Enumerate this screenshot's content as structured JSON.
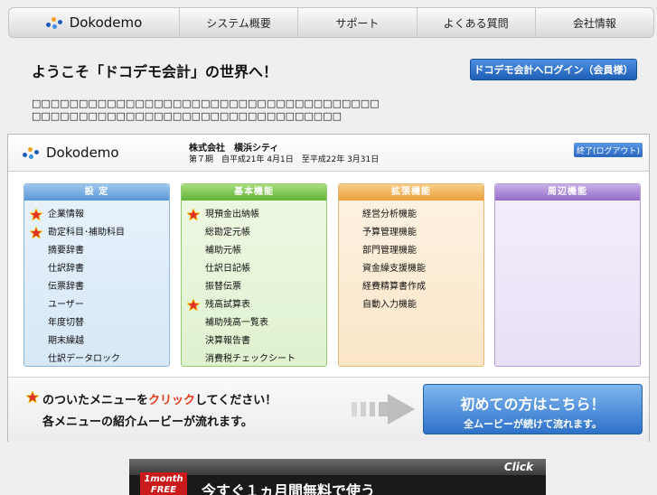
{
  "nav": {
    "logo_text": "Dokodemo",
    "items": [
      {
        "label": "システム概要"
      },
      {
        "label": "サポート"
      },
      {
        "label": "よくある質問"
      },
      {
        "label": "会社情報"
      }
    ]
  },
  "headline": "ようこそ「ドコデモ会計」の世界へ！",
  "login_button": "ドコデモ会計へログイン（会員様）",
  "intro_lines": [
    "□□□□□□□□□□□□□□□□□□□□□□□□□□□□□□□□□□□□□",
    "□□□□□□□□□□□□□□□□□□□□□□□□□□□□□□□□□"
  ],
  "app": {
    "logo_text": "Dokodemo",
    "company": "株式会社　横浜シティ",
    "period": "第７期　自平成21年 4月1日　至平成22年 3月31日",
    "logout": "終了(ログアウト)"
  },
  "panels": [
    {
      "title": "設 定",
      "items": [
        {
          "label": "企業情報",
          "star": true
        },
        {
          "label": "勘定科目･補助科目",
          "star": true
        },
        {
          "label": "摘要辞書",
          "star": false
        },
        {
          "label": "仕訳辞書",
          "star": false
        },
        {
          "label": "伝票辞書",
          "star": false
        },
        {
          "label": "ユーザー",
          "star": false
        },
        {
          "label": "年度切替",
          "star": false
        },
        {
          "label": "期末繰越",
          "star": false
        },
        {
          "label": "仕訳データロック",
          "star": false
        }
      ]
    },
    {
      "title": "基本機能",
      "items": [
        {
          "label": "現預金出納帳",
          "star": true
        },
        {
          "label": "総勘定元帳",
          "star": false
        },
        {
          "label": "補助元帳",
          "star": false
        },
        {
          "label": "仕訳日記帳",
          "star": false
        },
        {
          "label": "振替伝票",
          "star": false
        },
        {
          "label": "残高試算表",
          "star": true
        },
        {
          "label": "補助残高一覧表",
          "star": false
        },
        {
          "label": "決算報告書",
          "star": false
        },
        {
          "label": "消費税チェックシート",
          "star": false
        }
      ]
    },
    {
      "title": "拡張機能",
      "items": [
        {
          "label": "経営分析機能",
          "star": false
        },
        {
          "label": "予算管理機能",
          "star": false
        },
        {
          "label": "部門管理機能",
          "star": false
        },
        {
          "label": "資金繰支援機能",
          "star": false
        },
        {
          "label": "経費精算書作成",
          "star": false
        },
        {
          "label": "自動入力機能",
          "star": false
        }
      ]
    },
    {
      "title": "周辺機能",
      "items": []
    }
  ],
  "tips": {
    "line1_prefix": "のついたメニューを",
    "line1_click": "クリック",
    "line1_suffix": "してください！",
    "line2": "各メニューの紹介ムービーが流れます。"
  },
  "first_time": {
    "title": "初めての方はこちら！",
    "subtitle": "全ムービーが続けて流れます。"
  },
  "banner": {
    "click": "Click",
    "badge_line1": "1month",
    "badge_line2": "FREE",
    "text": "今すぐ１ヵ月間無料で使う"
  },
  "colors": {
    "star": "#e0302a",
    "link_blue": "#2e72c9"
  }
}
